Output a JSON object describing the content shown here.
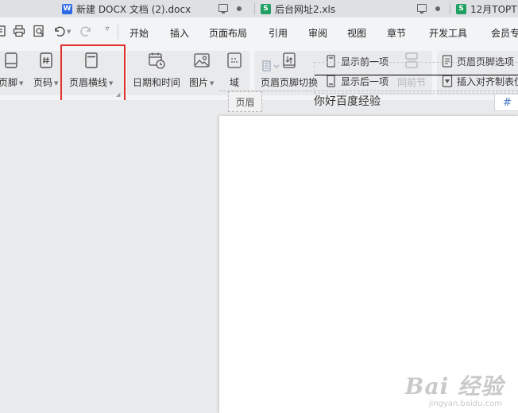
{
  "tabs": [
    {
      "badge": "W",
      "badge_color": "#2e6ae6",
      "title": "新建 DOCX 文档 (2).docx"
    },
    {
      "badge": "S",
      "badge_color": "#20a162",
      "title": "后台网址2.xls"
    },
    {
      "badge": "S",
      "badge_color": "#20a162",
      "title": "12月TOPT"
    }
  ],
  "menu": {
    "items": [
      "开始",
      "插入",
      "页面布局",
      "引用",
      "审阅",
      "视图",
      "章节",
      "开发工具",
      "会员专"
    ]
  },
  "ribbon": {
    "footer_label": "页脚",
    "page_number_label": "页码",
    "header_line_label": "页眉横线",
    "datetime_label": "日期和时间",
    "picture_label": "图片",
    "field_label": "域",
    "switch_label": "页眉页脚切换",
    "show_prev_label": "显示前一项",
    "show_next_label": "显示后一项",
    "same_as_prev_label": "同前节",
    "options_label": "页眉页脚选项",
    "insert_tab_label": "插入对齐制表位"
  },
  "document": {
    "header_tag": "页眉",
    "body_text": "你好百度经验",
    "side_tool_symbol": "#"
  },
  "watermark": {
    "brand": "Bai 经验",
    "url": "jingyan.baidu.com"
  },
  "colors": {
    "highlight": "#e0302b",
    "word_blue": "#2e6ae6",
    "sheet_green": "#20a162"
  }
}
